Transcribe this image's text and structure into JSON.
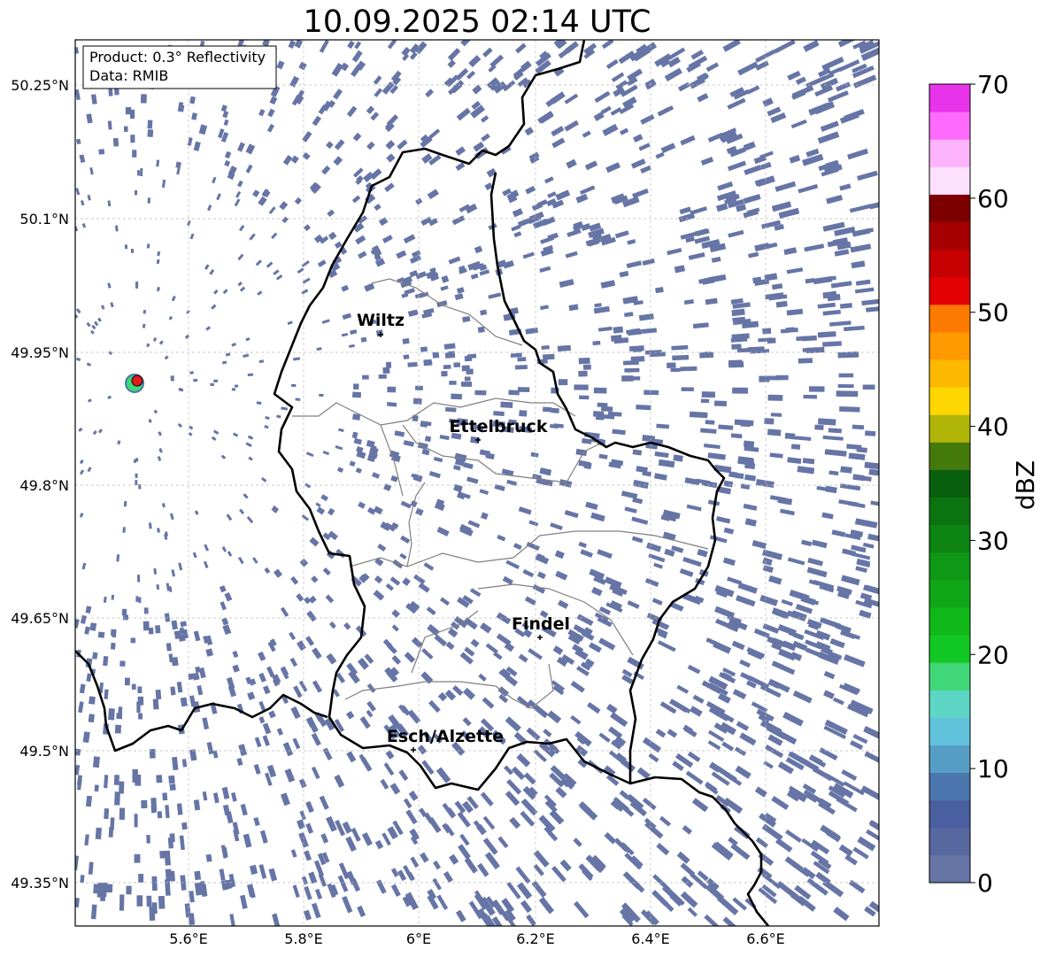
{
  "title": "10.09.2025 02:14 UTC",
  "info_box": {
    "product": "Product: 0.3° Reflectivity",
    "data": "Data: RMIB"
  },
  "axes": {
    "lon_ticks": [
      "5.6°E",
      "5.8°E",
      "6°E",
      "6.2°E",
      "6.4°E",
      "6.6°E"
    ],
    "lat_ticks": [
      "50.25°N",
      "50.1°N",
      "49.95°N",
      "49.8°N",
      "49.65°N",
      "49.5°N",
      "49.35°N"
    ]
  },
  "cities": [
    {
      "name": "Wiltz"
    },
    {
      "name": "Ettelbruck"
    },
    {
      "name": "Findel"
    },
    {
      "name": "Esch/Alzette"
    }
  ],
  "colorbar": {
    "label": "dBZ",
    "ticks": [
      "0",
      "10",
      "20",
      "30",
      "40",
      "50",
      "60",
      "70"
    ],
    "colors": [
      "#6675a6",
      "#5767a0",
      "#4a5fa0",
      "#4b75ad",
      "#569dc6",
      "#63c3dc",
      "#5ed6c6",
      "#40d778",
      "#12c824",
      "#11b81a",
      "#10a818",
      "#0f9815",
      "#0e8512",
      "#0b7410",
      "#085f0d",
      "#447a0c",
      "#b0b507",
      "#fed700",
      "#fdb800",
      "#fe9900",
      "#fd7a00",
      "#e30000",
      "#c60000",
      "#a70000",
      "#7c0000",
      "#fde0fe",
      "#feb4fc",
      "#fd6afc",
      "#e834ea"
    ]
  },
  "colors": {
    "echo": "#6675a6",
    "border": "#000000",
    "district": "#808080",
    "radar_site": "#e31a1c"
  }
}
